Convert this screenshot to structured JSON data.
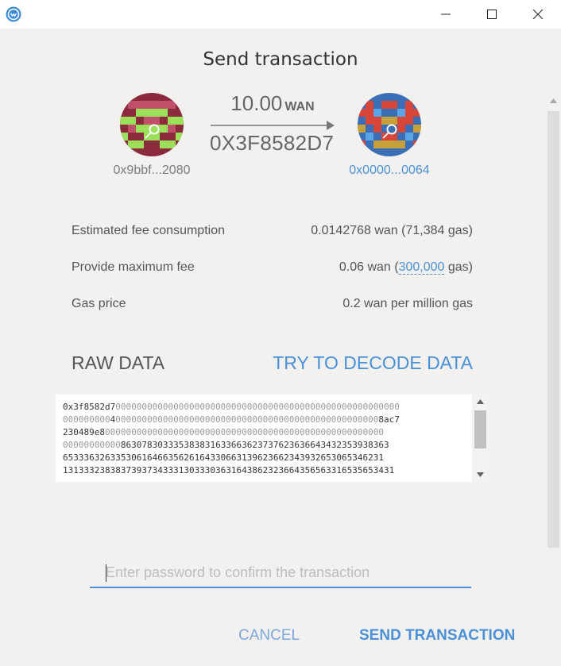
{
  "window": {
    "icon": "wanchain-wallet-icon",
    "controls": [
      "minimize-icon",
      "maximize-icon",
      "close-icon"
    ]
  },
  "dialog": {
    "title": "Send transaction",
    "from": {
      "address_short": "0x9bbf...2080",
      "avatar_icon": "identicon-icon"
    },
    "to": {
      "address_short": "0x0000...0064",
      "avatar_icon": "identicon-icon"
    },
    "amount": {
      "value": "10.00",
      "unit": "WAN"
    },
    "destination": "0X3F8582D7"
  },
  "fees": {
    "estimated_label": "Estimated fee consumption",
    "estimated_value": "0.0142768 wan (71,384 gas)",
    "max_label": "Provide maximum fee",
    "max_prefix": "0.06 wan (",
    "max_gas": "300,000",
    "max_suffix": " gas)",
    "gas_price_label": "Gas price",
    "gas_price_value": "0.2 wan per million gas"
  },
  "raw": {
    "label": "RAW DATA",
    "decode_label": "TRY TO DECODE DATA",
    "lines": [
      [
        "0x3f8582d7",
        "000000000000000000000000000000000000000000000000000000"
      ],
      [
        "000000000",
        "4",
        "00000000000000000000000000000000000000000000000000",
        "8ac7"
      ],
      [
        "230489e8",
        "00000000000000000000000000000000000000000000000000000"
      ],
      [
        "00000000000",
        "863078303335383831633663623737623636643432353938363"
      ],
      [
        "6533363263353061646635626164330663139623662343932653065346231",
        ""
      ],
      [
        "1313332383837393734333130333036316438623236643565633165356534",
        "31"
      ]
    ]
  },
  "password": {
    "placeholder": "Enter password to confirm the transaction"
  },
  "buttons": {
    "cancel": "CANCEL",
    "send": "SEND TRANSACTION"
  },
  "colors": {
    "accent": "#4a90d9",
    "background": "#f2f1f0"
  }
}
